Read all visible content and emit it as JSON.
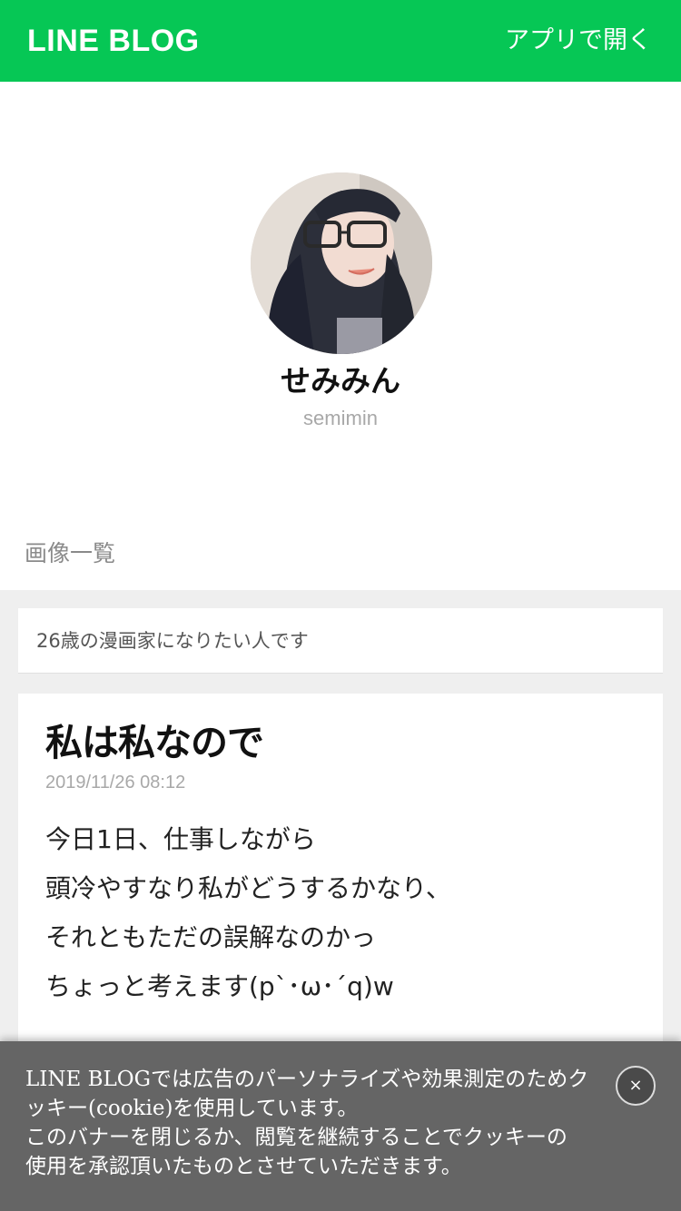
{
  "header": {
    "logo_text": "LINE BLOG",
    "open_app_label": "アプリで開く",
    "brand_color": "#06c755"
  },
  "profile": {
    "name": "せみみん",
    "id": "semimin",
    "avatar": "profile-photo"
  },
  "nav": {
    "image_list_label": "画像一覧"
  },
  "bio": {
    "text": "26歳の漫画家になりたい人です"
  },
  "post": {
    "title": "私は私なので",
    "date": "2019/11/26 08:12",
    "body_lines": [
      "今日1日、仕事しながら",
      "頭冷やすなり私がどうするかなり、",
      "それともただの誤解なのかっ",
      "ちょっと考えます(p`･ω･´q)w"
    ]
  },
  "cookie_banner": {
    "text_lines": [
      "LINE BLOGでは広告のパーソナライズや効果測定のためク",
      "ッキー(cookie)を使用しています。",
      "このバナーを閉じるか、閲覧を継続することでクッキーの",
      "使用を承認頂いたものとさせていただきます。"
    ],
    "close_label": "×"
  }
}
